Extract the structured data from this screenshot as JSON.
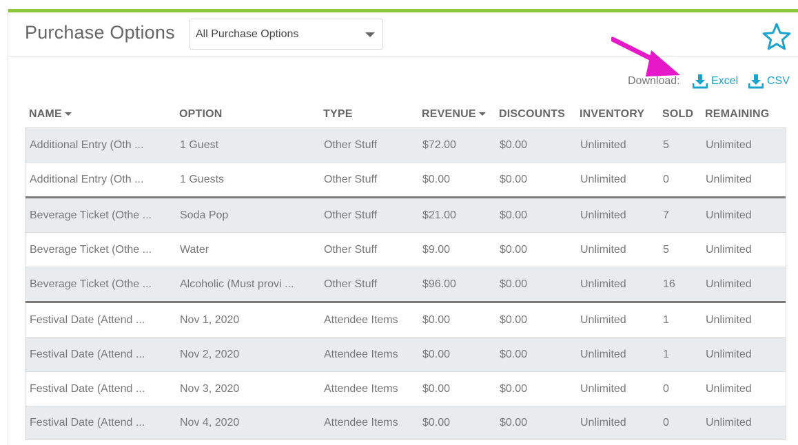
{
  "header": {
    "title": "Purchase Options",
    "filter": {
      "selected": "All Purchase Options"
    },
    "favorite_icon": "star-outline-icon"
  },
  "colors": {
    "accent_bar": "#8cc63f",
    "link": "#1aa3cc",
    "annotation_arrow": "#e619c8",
    "row_alt": "#e9ecef"
  },
  "download": {
    "label": "Download:",
    "excel": "Excel",
    "csv": "CSV",
    "icon": "download-icon"
  },
  "table": {
    "columns": [
      "NAME",
      "OPTION",
      "TYPE",
      "REVENUE",
      "DISCOUNTS",
      "INVENTORY",
      "SOLD",
      "REMAINING"
    ],
    "rows": [
      {
        "name": "Additional Entry (Oth ...",
        "option": "1 Guest",
        "type": "Other Stuff",
        "revenue": "$72.00",
        "discounts": "$0.00",
        "inventory": "Unlimited",
        "sold": "5",
        "remaining": "Unlimited"
      },
      {
        "name": "Additional Entry (Oth ...",
        "option": "1 Guests",
        "type": "Other Stuff",
        "revenue": "$0.00",
        "discounts": "$0.00",
        "inventory": "Unlimited",
        "sold": "0",
        "remaining": "Unlimited"
      },
      {
        "name": "Beverage Ticket (Othe ...",
        "option": "Soda Pop",
        "type": "Other Stuff",
        "revenue": "$21.00",
        "discounts": "$0.00",
        "inventory": "Unlimited",
        "sold": "7",
        "remaining": "Unlimited"
      },
      {
        "name": "Beverage Ticket (Othe ...",
        "option": "Water",
        "type": "Other Stuff",
        "revenue": "$9.00",
        "discounts": "$0.00",
        "inventory": "Unlimited",
        "sold": "5",
        "remaining": "Unlimited"
      },
      {
        "name": "Beverage Ticket (Othe ...",
        "option": "Alcoholic (Must provi ...",
        "type": "Other Stuff",
        "revenue": "$96.00",
        "discounts": "$0.00",
        "inventory": "Unlimited",
        "sold": "16",
        "remaining": "Unlimited"
      },
      {
        "name": "Festival Date (Attend ...",
        "option": "Nov 1, 2020",
        "type": "Attendee Items",
        "revenue": "$0.00",
        "discounts": "$0.00",
        "inventory": "Unlimited",
        "sold": "1",
        "remaining": "Unlimited"
      },
      {
        "name": "Festival Date (Attend ...",
        "option": "Nov 2, 2020",
        "type": "Attendee Items",
        "revenue": "$0.00",
        "discounts": "$0.00",
        "inventory": "Unlimited",
        "sold": "1",
        "remaining": "Unlimited"
      },
      {
        "name": "Festival Date (Attend ...",
        "option": "Nov 3, 2020",
        "type": "Attendee Items",
        "revenue": "$0.00",
        "discounts": "$0.00",
        "inventory": "Unlimited",
        "sold": "0",
        "remaining": "Unlimited"
      },
      {
        "name": "Festival Date (Attend ...",
        "option": "Nov 4, 2020",
        "type": "Attendee Items",
        "revenue": "$0.00",
        "discounts": "$0.00",
        "inventory": "Unlimited",
        "sold": "0",
        "remaining": "Unlimited"
      }
    ]
  }
}
